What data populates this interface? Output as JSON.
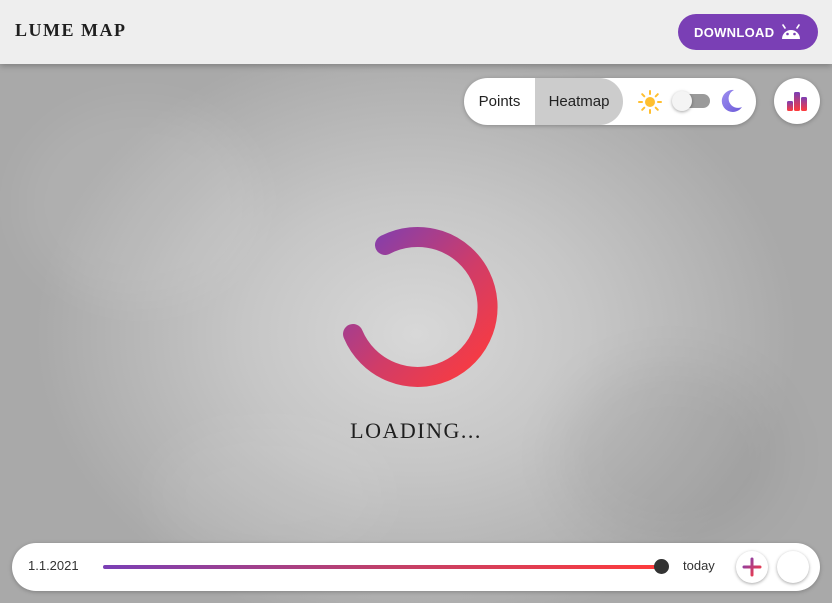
{
  "header": {
    "brand": "LUME MAP",
    "download_label": "DOWNLOAD",
    "download_icon": "android-icon"
  },
  "map_controls": {
    "tabs": [
      {
        "label": "Points",
        "selected": false
      },
      {
        "label": "Heatmap",
        "selected": true
      }
    ],
    "theme_toggle": {
      "left_icon": "sun-icon",
      "right_icon": "moon-icon",
      "state": "light"
    },
    "stats_icon": "bar-chart-icon"
  },
  "loading": {
    "text": "LOADING...",
    "colors": {
      "start": "#7a3fb5",
      "end": "#ff3b3b"
    }
  },
  "timeline": {
    "start_label": "1.1.2021",
    "end_label": "today",
    "position": 1.0,
    "zoom_in_icon": "plus-icon",
    "zoom_out_icon": "minus-icon"
  },
  "colors": {
    "accent": "#7a3fb5",
    "gradient_start": "#7a3fb5",
    "gradient_end": "#ff3b3b"
  }
}
